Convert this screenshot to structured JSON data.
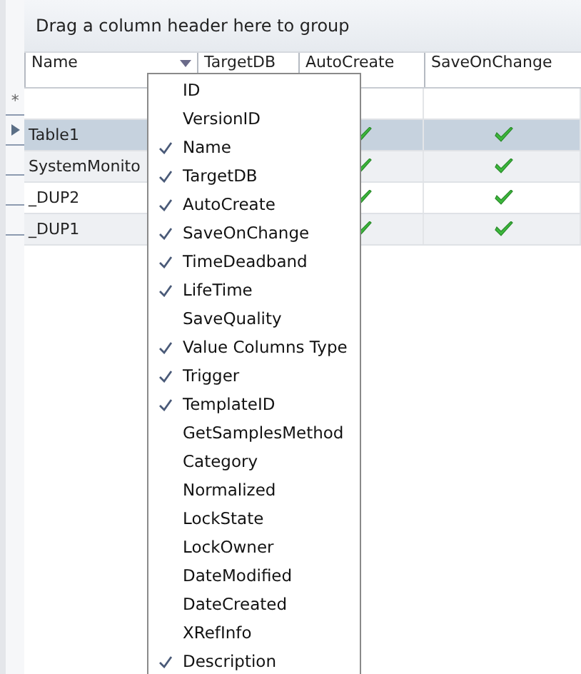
{
  "group_panel": {
    "text": "Drag a column header here to group"
  },
  "columns": [
    {
      "label": "Name",
      "has_menu": true
    },
    {
      "label": "TargetDB",
      "has_menu": false
    },
    {
      "label": "AutoCreate",
      "has_menu": false
    },
    {
      "label": "SaveOnChange",
      "has_menu": false
    }
  ],
  "new_row": {
    "indicator": "*"
  },
  "rows": [
    {
      "name": "Table1",
      "auto_create": true,
      "save_on_change": true,
      "selected": true
    },
    {
      "name": "SystemMonito",
      "auto_create": true,
      "save_on_change": true,
      "selected": false
    },
    {
      "name": "_DUP2",
      "auto_create": true,
      "save_on_change": true,
      "selected": false
    },
    {
      "name": "_DUP1",
      "auto_create": true,
      "save_on_change": true,
      "selected": false
    }
  ],
  "column_menu": [
    {
      "label": "ID",
      "checked": false
    },
    {
      "label": "VersionID",
      "checked": false
    },
    {
      "label": "Name",
      "checked": true
    },
    {
      "label": "TargetDB",
      "checked": true
    },
    {
      "label": "AutoCreate",
      "checked": true
    },
    {
      "label": "SaveOnChange",
      "checked": true
    },
    {
      "label": "TimeDeadband",
      "checked": true
    },
    {
      "label": "LifeTime",
      "checked": true
    },
    {
      "label": "SaveQuality",
      "checked": false
    },
    {
      "label": "Value Columns Type",
      "checked": true
    },
    {
      "label": "Trigger",
      "checked": true
    },
    {
      "label": "TemplateID",
      "checked": true
    },
    {
      "label": "GetSamplesMethod",
      "checked": false
    },
    {
      "label": "Category",
      "checked": false
    },
    {
      "label": "Normalized",
      "checked": false
    },
    {
      "label": "LockState",
      "checked": false
    },
    {
      "label": "LockOwner",
      "checked": false
    },
    {
      "label": "DateModified",
      "checked": false
    },
    {
      "label": "DateCreated",
      "checked": false
    },
    {
      "label": "XRefInfo",
      "checked": false
    },
    {
      "label": "Description",
      "checked": true
    }
  ]
}
